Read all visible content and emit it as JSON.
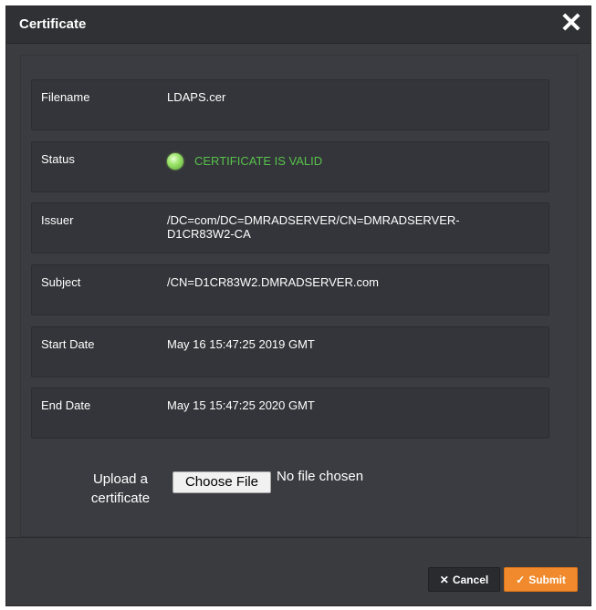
{
  "dialog": {
    "title": "Certificate",
    "close_glyph": "✕"
  },
  "fields": [
    {
      "label": "Filename",
      "value": "LDAPS.cer"
    },
    {
      "label": "Status",
      "value": "CERTIFICATE IS VALID",
      "indicator_color": "#7fd04f"
    },
    {
      "label": "Issuer",
      "value": "/DC=com/DC=DMRADSERVER/CN=DMRADSERVER-D1CR83W2-CA"
    },
    {
      "label": "Subject",
      "value": "/CN=D1CR83W2.DMRADSERVER.com"
    },
    {
      "label": "Start Date",
      "value": "May 16 15:47:25 2019 GMT"
    },
    {
      "label": "End Date",
      "value": "May 15 15:47:25 2020 GMT"
    }
  ],
  "upload": {
    "label_line1": "Upload a",
    "label_line2": "certificate",
    "button_label": "Choose File",
    "status_text": "No file chosen"
  },
  "footer": {
    "cancel_icon": "✕",
    "cancel_label": "Cancel",
    "submit_icon": "✓",
    "submit_label": "Submit"
  },
  "colors": {
    "accent_submit": "#f08a2c",
    "status_valid": "#57c24a",
    "dialog_bg": "#3b3c40"
  },
  "icons": [
    "close-icon",
    "status-indicator-icon",
    "cancel-x-icon",
    "submit-check-icon"
  ]
}
